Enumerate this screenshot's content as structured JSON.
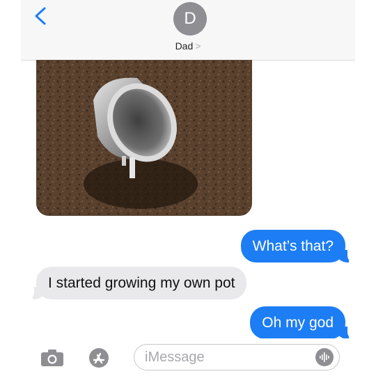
{
  "header": {
    "avatar_initial": "D",
    "contact_name": "Dad",
    "contact_chevron": ">"
  },
  "thread": {
    "attachment_icon": "photo-attachment",
    "messages": [
      {
        "direction": "sent",
        "text": "What’s that?"
      },
      {
        "direction": "received",
        "text": "I started growing my own pot"
      },
      {
        "direction": "sent",
        "text": "Oh my god"
      }
    ]
  },
  "composer": {
    "placeholder": "iMessage",
    "camera_icon": "camera-icon",
    "apps_icon": "app-store-icon",
    "audio_icon": "audio-waveform-icon"
  },
  "colors": {
    "accent_blue": "#1d7df5",
    "received_bubble": "#e9e9eb",
    "header_bg": "#f7f7f7",
    "avatar": "#8e8e93"
  }
}
